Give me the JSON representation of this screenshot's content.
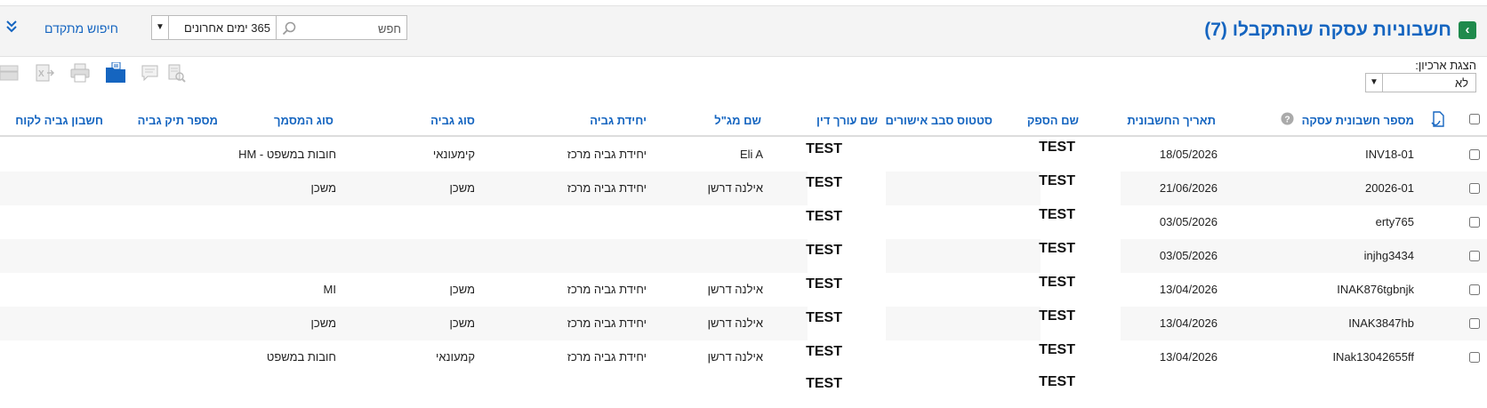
{
  "header": {
    "title": "חשבוניות עסקה שהתקבלו (7)",
    "back_icon": "chevron-left-icon",
    "search_placeholder": "חפש",
    "period_value": "365 ימים אחרונים",
    "advanced_search": "חיפוש מתקדם",
    "accent_color": "#1565c0",
    "back_color": "#1f8a4c"
  },
  "archive": {
    "label": "הצגת ארכיון:",
    "value": "לא"
  },
  "toolbar": {
    "icons": [
      "doc-search-icon",
      "comment-icon",
      "folder-open-icon",
      "print-icon",
      "excel-export-icon",
      "stack-icon"
    ]
  },
  "columns": {
    "invoice_number": "מספר חשבונית עסקה",
    "invoice_date": "תאריך החשבונית",
    "supplier": "שם הספק",
    "approval_status": "סטטוס סבב אישורים",
    "lawyer": "שם עורך דין",
    "manager": "שם מג\"ל",
    "unit": "יחידת גביה",
    "collection_type": "סוג גביה",
    "doc_type": "סוג המסמך",
    "case_number": "מספר תיק גביה",
    "customer_account": "חשבון גביה לקוח"
  },
  "rows": [
    {
      "invoice_number": "INV18-01",
      "invoice_date": "18/05/2026",
      "supplier": "TEST",
      "approval_status": "",
      "lawyer": "TEST",
      "manager": "Eli A",
      "unit": "יחידת גביה מרכז",
      "collection_type": "קימעונאי",
      "doc_type": "חובות במשפט - HM",
      "case_number": "",
      "customer_account": ""
    },
    {
      "invoice_number": "20026-01",
      "invoice_date": "21/06/2026",
      "supplier": "TEST",
      "approval_status": "",
      "lawyer": "TEST",
      "manager": "אילנה דרשן",
      "unit": "יחידת גביה מרכז",
      "collection_type": "משכן",
      "doc_type": "משכן",
      "case_number": "",
      "customer_account": ""
    },
    {
      "invoice_number": "erty765",
      "invoice_date": "03/05/2026",
      "supplier": "TEST",
      "approval_status": "",
      "lawyer": "TEST",
      "manager": "",
      "unit": "",
      "collection_type": "",
      "doc_type": "",
      "case_number": "",
      "customer_account": ""
    },
    {
      "invoice_number": "injhg3434",
      "invoice_date": "03/05/2026",
      "supplier": "TEST",
      "approval_status": "",
      "lawyer": "TEST",
      "manager": "",
      "unit": "",
      "collection_type": "",
      "doc_type": "",
      "case_number": "",
      "customer_account": ""
    },
    {
      "invoice_number": "INAK876tgbnjk",
      "invoice_date": "13/04/2026",
      "supplier": "TEST",
      "approval_status": "",
      "lawyer": "TEST",
      "manager": "אילנה דרשן",
      "unit": "יחידת גביה מרכז",
      "collection_type": "משכן",
      "doc_type": "MI",
      "case_number": "",
      "customer_account": ""
    },
    {
      "invoice_number": "INAK3847hb",
      "invoice_date": "13/04/2026",
      "supplier": "TEST",
      "approval_status": "",
      "lawyer": "TEST",
      "manager": "אילנה דרשן",
      "unit": "יחידת גביה מרכז",
      "collection_type": "משכן",
      "doc_type": "משכן",
      "case_number": "",
      "customer_account": ""
    },
    {
      "invoice_number": "INak13042655ff",
      "invoice_date": "13/04/2026",
      "supplier": "TEST",
      "approval_status": "",
      "lawyer": "TEST",
      "manager": "אילנה דרשן",
      "unit": "יחידת גביה מרכז",
      "collection_type": "קמעונאי",
      "doc_type": "חובות במשפט",
      "case_number": "",
      "customer_account": ""
    },
    {
      "invoice_number": "",
      "invoice_date": "",
      "supplier": "TEST",
      "approval_status": "",
      "lawyer": "TEST",
      "manager": "",
      "unit": "",
      "collection_type": "",
      "doc_type": "",
      "case_number": "",
      "customer_account": ""
    }
  ]
}
